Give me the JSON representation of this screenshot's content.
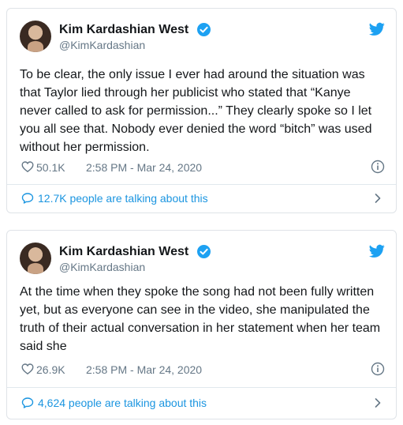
{
  "tweets": [
    {
      "author_name": "Kim Kardashian West",
      "handle": "@KimKardashian",
      "text": "To be clear, the only issue I ever had around the situation was that Taylor lied through her publicist who stated that “Kanye never called to ask for permission...” They clearly spoke so I let you all see that. Nobody ever denied the word “bitch” was used without her permission.",
      "likes": "50.1K",
      "timestamp": "2:58 PM - Mar 24, 2020",
      "talking": "12.7K people are talking about this"
    },
    {
      "author_name": "Kim Kardashian West",
      "handle": "@KimKardashian",
      "text": "At the time when they spoke the song had not been fully written yet, but as everyone can see in the video, she manipulated the truth of their actual conversation in her statement when her team said she",
      "likes": "26.9K",
      "timestamp": "2:58 PM - Mar 24, 2020",
      "talking": "4,624 people are talking about this"
    }
  ],
  "colors": {
    "accent": "#1da1f2",
    "link": "#1b95e0",
    "muted": "#657786",
    "text": "#14171a",
    "border": "#dfe3e8"
  },
  "icons": [
    "avatar",
    "verified-badge-icon",
    "twitter-bird-icon",
    "heart-icon",
    "info-icon",
    "speech-bubble-icon",
    "chevron-right-icon"
  ]
}
